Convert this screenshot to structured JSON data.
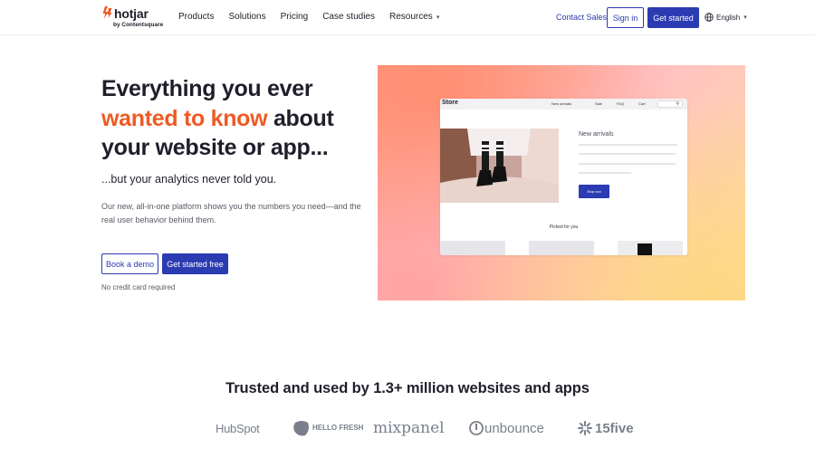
{
  "header": {
    "logo": {
      "name": "hotjar",
      "tagline": "by Contentsquare"
    },
    "nav": [
      {
        "label": "Products"
      },
      {
        "label": "Solutions"
      },
      {
        "label": "Pricing"
      },
      {
        "label": "Case studies"
      },
      {
        "label": "Resources",
        "has_dropdown": true
      }
    ],
    "contact_sales": "Contact Sales",
    "sign_in": "Sign in",
    "get_started": "Get started",
    "language": "English"
  },
  "hero": {
    "title_line1": "Everything you ever",
    "title_accent": "wanted to know",
    "title_after_accent": " about",
    "title_line3": "your website or app...",
    "subtitle": "...but your analytics never told you.",
    "description": "Our new, all-in-one platform shows you the numbers you need—and the real user behavior behind them.",
    "book_demo": "Book a demo",
    "get_started_free": "Get started free",
    "no_card": "No credit card required"
  },
  "store_mockup": {
    "name": "Store",
    "nav": [
      "New arrivals",
      "Sale",
      "FAQ",
      "Cart"
    ],
    "heading": "New arrivals",
    "cta": "Shop now",
    "picked": "Picked for you"
  },
  "trusted": {
    "heading": "Trusted and used by 1.3+ million websites and apps",
    "logos": [
      "HubSpot",
      "HELLO FRESH",
      "mixpanel",
      "unbounce",
      "15five"
    ]
  },
  "colors": {
    "accent": "#ee5a24",
    "primary": "#2b3bb2",
    "text": "#1f1f2b",
    "muted": "#5a5a66",
    "logo_gray": "#7a7f8c"
  }
}
